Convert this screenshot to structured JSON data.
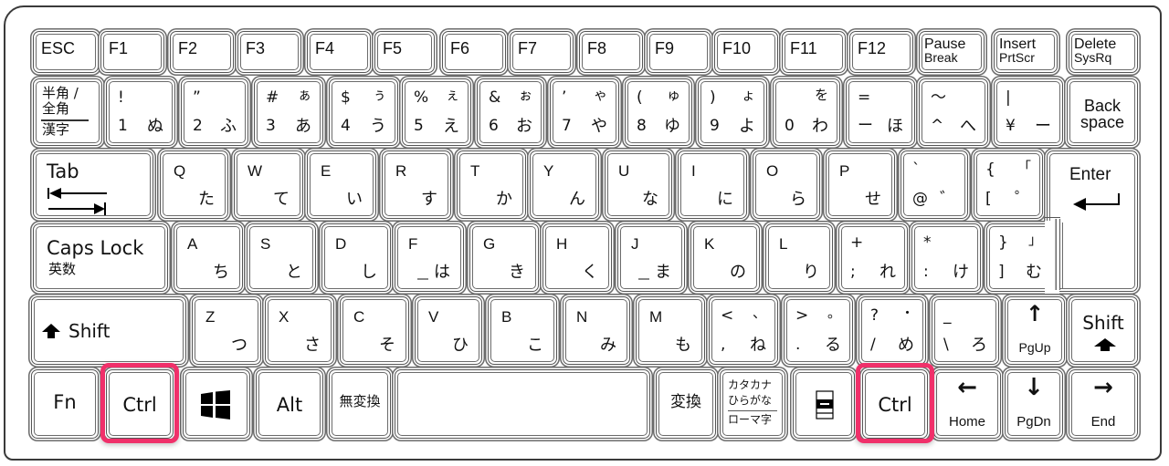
{
  "highlight_color": "#f0306a",
  "highlighted_keys": [
    "Ctrl",
    "Ctrl"
  ],
  "row1": [
    {
      "id": "esc",
      "label": "ESC"
    },
    {
      "id": "f1",
      "label": "F1"
    },
    {
      "id": "f2",
      "label": "F2"
    },
    {
      "id": "f3",
      "label": "F3"
    },
    {
      "id": "f4",
      "label": "F4"
    },
    {
      "id": "f5",
      "label": "F5"
    },
    {
      "id": "f6",
      "label": "F6"
    },
    {
      "id": "f7",
      "label": "F7"
    },
    {
      "id": "f8",
      "label": "F8"
    },
    {
      "id": "f9",
      "label": "F9"
    },
    {
      "id": "f10",
      "label": "F10"
    },
    {
      "id": "f11",
      "label": "F11"
    },
    {
      "id": "f12",
      "label": "F12"
    },
    {
      "id": "pause",
      "top": "Pause",
      "bottom": "Break"
    },
    {
      "id": "insert",
      "top": "Insert",
      "bottom": "PrtScr"
    },
    {
      "id": "delete",
      "top": "Delete",
      "bottom": "SysRq"
    }
  ],
  "row2": [
    {
      "id": "hankaku",
      "line1": "半角 /",
      "line2": "全角",
      "line3": "漢字"
    },
    {
      "id": "1",
      "shift": "!",
      "shift_kana": "",
      "base": "1",
      "kana": "ぬ"
    },
    {
      "id": "2",
      "shift": "”",
      "shift_kana": "",
      "base": "2",
      "kana": "ふ"
    },
    {
      "id": "3",
      "shift": "#",
      "shift_kana": "ぁ",
      "base": "3",
      "kana": "あ"
    },
    {
      "id": "4",
      "shift": "$",
      "shift_kana": "ぅ",
      "base": "4",
      "kana": "う"
    },
    {
      "id": "5",
      "shift": "%",
      "shift_kana": "ぇ",
      "base": "5",
      "kana": "え"
    },
    {
      "id": "6",
      "shift": "&",
      "shift_kana": "ぉ",
      "base": "6",
      "kana": "お"
    },
    {
      "id": "7",
      "shift": "’",
      "shift_kana": "ゃ",
      "base": "7",
      "kana": "や"
    },
    {
      "id": "8",
      "shift": "(",
      "shift_kana": "ゅ",
      "base": "8",
      "kana": "ゆ"
    },
    {
      "id": "9",
      "shift": ")",
      "shift_kana": "ょ",
      "base": "9",
      "kana": "よ"
    },
    {
      "id": "0",
      "shift": "",
      "shift_kana": "を",
      "base": "0",
      "kana": "わ"
    },
    {
      "id": "minus",
      "shift": "=",
      "shift_kana": "",
      "base": "ー",
      "kana": "ほ"
    },
    {
      "id": "caret",
      "shift": "～",
      "shift_kana": "",
      "base": "^",
      "kana": "へ"
    },
    {
      "id": "yen",
      "shift": "|",
      "shift_kana": "",
      "base": "¥",
      "kana": "ー"
    },
    {
      "id": "backspace",
      "top": "Back",
      "bottom": "space"
    }
  ],
  "row3": [
    {
      "id": "tab",
      "label": "Tab"
    },
    {
      "id": "q",
      "label": "Q",
      "kana": "た"
    },
    {
      "id": "w",
      "label": "W",
      "kana": "て"
    },
    {
      "id": "e",
      "label": "E",
      "kana": "い"
    },
    {
      "id": "r",
      "label": "R",
      "kana": "す"
    },
    {
      "id": "t",
      "label": "T",
      "kana": "か"
    },
    {
      "id": "y",
      "label": "Y",
      "kana": "ん"
    },
    {
      "id": "u",
      "label": "U",
      "kana": "な"
    },
    {
      "id": "i",
      "label": "I",
      "kana": "に"
    },
    {
      "id": "o",
      "label": "O",
      "kana": "ら"
    },
    {
      "id": "p",
      "label": "P",
      "kana": "せ"
    },
    {
      "id": "at",
      "shift": "`",
      "shift_kana": "",
      "base": "@",
      "kana": "゛"
    },
    {
      "id": "lbracket",
      "shift": "{",
      "shift_kana": "「",
      "base": "[",
      "kana": "゜"
    },
    {
      "id": "enter",
      "label": "Enter"
    }
  ],
  "row4": [
    {
      "id": "capslock",
      "label": "Caps Lock",
      "sub": "英数"
    },
    {
      "id": "a",
      "label": "A",
      "kana": "ち"
    },
    {
      "id": "s",
      "label": "S",
      "kana": "と"
    },
    {
      "id": "d",
      "label": "D",
      "kana": "し"
    },
    {
      "id": "f",
      "label": "F",
      "kana": "は"
    },
    {
      "id": "g",
      "label": "G",
      "kana": "き"
    },
    {
      "id": "h",
      "label": "H",
      "kana": "く"
    },
    {
      "id": "j",
      "label": "J",
      "kana": "ま"
    },
    {
      "id": "k",
      "label": "K",
      "kana": "の"
    },
    {
      "id": "l",
      "label": "L",
      "kana": "り"
    },
    {
      "id": "semicolon",
      "shift": "+",
      "shift_kana": "",
      "base": ";",
      "kana": "れ"
    },
    {
      "id": "colon",
      "shift": "*",
      "shift_kana": "",
      "base": ":",
      "kana": "け"
    },
    {
      "id": "rbracket",
      "shift": "}",
      "shift_kana": "」",
      "base": "]",
      "kana": "む"
    }
  ],
  "row5": [
    {
      "id": "lshift",
      "label": "Shift"
    },
    {
      "id": "z",
      "label": "Z",
      "kana": "つ"
    },
    {
      "id": "x",
      "label": "X",
      "kana": "さ"
    },
    {
      "id": "c",
      "label": "C",
      "kana": "そ"
    },
    {
      "id": "v",
      "label": "V",
      "kana": "ひ"
    },
    {
      "id": "b",
      "label": "B",
      "kana": "こ"
    },
    {
      "id": "n",
      "label": "N",
      "kana": "み"
    },
    {
      "id": "m",
      "label": "M",
      "kana": "も"
    },
    {
      "id": "comma",
      "shift": "<",
      "shift_kana": "、",
      "base": ",",
      "kana": "ね"
    },
    {
      "id": "period",
      "shift": ">",
      "shift_kana": "。",
      "base": ".",
      "kana": "る"
    },
    {
      "id": "slash",
      "shift": "?",
      "shift_kana": "・",
      "base": "/",
      "kana": "め"
    },
    {
      "id": "backslash",
      "shift": "_",
      "shift_kana": "",
      "base": "\\",
      "kana": "ろ"
    },
    {
      "id": "pgup",
      "arrow": "↑",
      "label": "PgUp"
    },
    {
      "id": "rshift",
      "label": "Shift"
    }
  ],
  "row6": [
    {
      "id": "fn",
      "label": "Fn"
    },
    {
      "id": "lctrl",
      "label": "Ctrl"
    },
    {
      "id": "win",
      "label": ""
    },
    {
      "id": "alt",
      "label": "Alt"
    },
    {
      "id": "muhenkan",
      "label": "無変換"
    },
    {
      "id": "space",
      "label": ""
    },
    {
      "id": "henkan",
      "label": "変換"
    },
    {
      "id": "kana",
      "line1": "カタカナ",
      "line2": "ひらがな",
      "line3": "ローマ字"
    },
    {
      "id": "menu",
      "label": ""
    },
    {
      "id": "rctrl",
      "label": "Ctrl"
    },
    {
      "id": "home",
      "arrow": "←",
      "label": "Home"
    },
    {
      "id": "pgdn",
      "arrow": "↓",
      "label": "PgDn"
    },
    {
      "id": "end",
      "arrow": "→",
      "label": "End"
    }
  ]
}
